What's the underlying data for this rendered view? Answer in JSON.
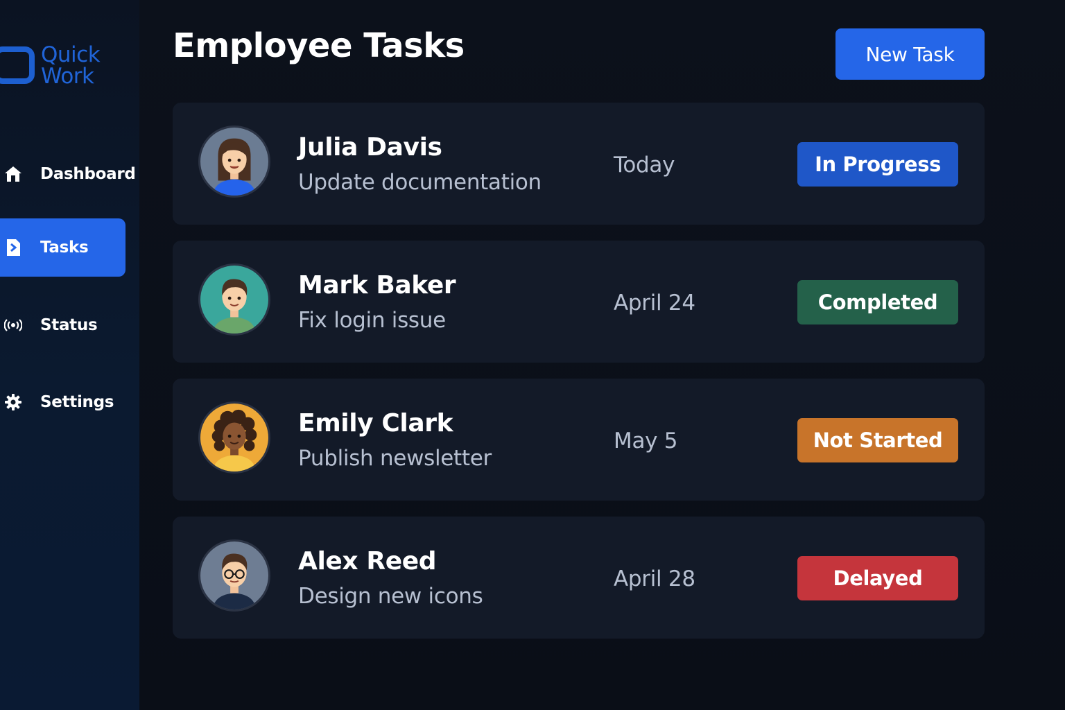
{
  "brand": {
    "line1": "Quick",
    "line2": "Work",
    "color": "#2064d8"
  },
  "sidebar": {
    "items": [
      {
        "label": "Dashboard",
        "icon": "home-icon",
        "active": false
      },
      {
        "label": "Tasks",
        "icon": "document-icon",
        "active": true
      },
      {
        "label": "Status",
        "icon": "broadcast-icon",
        "active": false
      },
      {
        "label": "Settings",
        "icon": "gear-icon",
        "active": false
      }
    ]
  },
  "header": {
    "title": "Employee Tasks",
    "new_task_label": "New Task"
  },
  "tasks": [
    {
      "name": "Julia Davis",
      "task": "Update documentation",
      "due": "Today",
      "status": "In Progress",
      "status_color": "#1f57c8",
      "avatar_bg": "#6b7c93"
    },
    {
      "name": "Mark Baker",
      "task": "Fix login issue",
      "due": "April 24",
      "status": "Completed",
      "status_color": "#24614a",
      "avatar_bg": "#3aa79c"
    },
    {
      "name": "Emily Clark",
      "task": "Publish newsletter",
      "due": "May 5",
      "status": "Not Started",
      "status_color": "#c8742a",
      "avatar_bg": "#eea938"
    },
    {
      "name": "Alex Reed",
      "task": "Design new icons",
      "due": "April 28",
      "status": "Delayed",
      "status_color": "#c5353c",
      "avatar_bg": "#6e7d93"
    }
  ],
  "colors": {
    "accent": "#2566e8",
    "card": "#131a28",
    "background": "#0b0f18"
  }
}
